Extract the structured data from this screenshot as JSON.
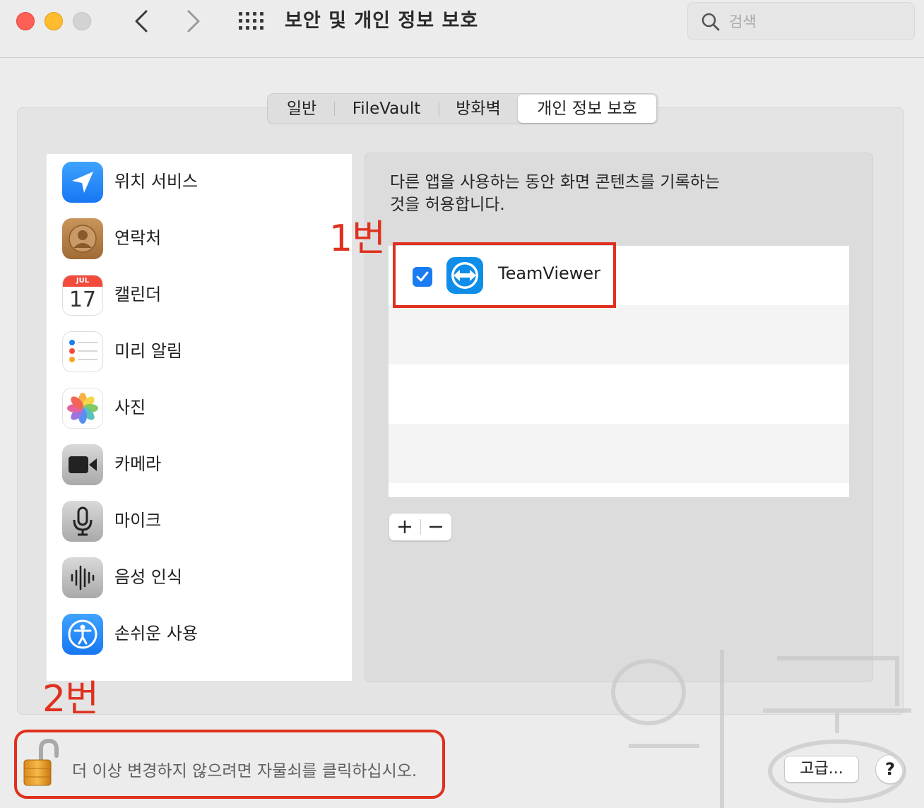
{
  "window": {
    "title": "보안 및 개인 정보 보호",
    "search_placeholder": "검색"
  },
  "tabs": [
    {
      "label": "일반",
      "active": false
    },
    {
      "label": "FileVault",
      "active": false
    },
    {
      "label": "방화벽",
      "active": false
    },
    {
      "label": "개인 정보 보호",
      "active": true
    }
  ],
  "sidebar": {
    "items": [
      {
        "label": "위치 서비스",
        "icon": "location-arrow-icon"
      },
      {
        "label": "연락처",
        "icon": "contacts-icon"
      },
      {
        "label": "캘린더",
        "icon": "calendar-icon",
        "calendar_month": "JUL",
        "calendar_day": "17"
      },
      {
        "label": "미리 알림",
        "icon": "reminders-icon"
      },
      {
        "label": "사진",
        "icon": "photos-icon"
      },
      {
        "label": "카메라",
        "icon": "camera-icon"
      },
      {
        "label": "마이크",
        "icon": "microphone-icon"
      },
      {
        "label": "음성 인식",
        "icon": "speech-recognition-icon"
      },
      {
        "label": "손쉬운 사용",
        "icon": "accessibility-icon"
      }
    ]
  },
  "detail": {
    "description_line1": "다른 앱을 사용하는 동안 화면 콘텐츠를 기록하는",
    "description_line2": "것을 허용합니다.",
    "apps": [
      {
        "name": "TeamViewer",
        "checked": true,
        "icon": "teamviewer-icon"
      }
    ]
  },
  "annotations": {
    "label_1": "1번",
    "label_2": "2번"
  },
  "footer": {
    "lock_text": "더 이상 변경하지 않으려면 자물쇠를 클릭하십시오.",
    "advanced_label": "고급...",
    "help_label": "?"
  },
  "colors": {
    "accent_blue": "#1a7bf2",
    "annotation_red": "#e0301e",
    "close_red": "#fe5f57",
    "minimize_yellow": "#febc2e"
  }
}
